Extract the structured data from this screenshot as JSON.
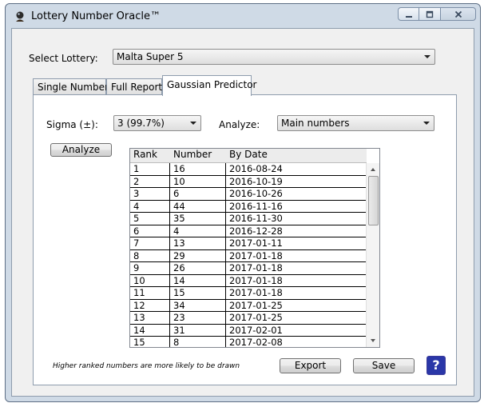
{
  "window": {
    "title": "Lottery Number Oracle™"
  },
  "select_lottery": {
    "label": "Select Lottery:",
    "value": "Malta Super 5"
  },
  "tabs": [
    {
      "label": "Single Number"
    },
    {
      "label": "Full Report"
    },
    {
      "label": "Gaussian Predictor"
    }
  ],
  "active_tab": "Gaussian Predictor",
  "sigma": {
    "label": "Sigma (±):",
    "value": "3 (99.7%)"
  },
  "analyze_select": {
    "label": "Analyze:",
    "value": "Main numbers"
  },
  "analyze_button": "Analyze",
  "table": {
    "columns": [
      "Rank",
      "Number",
      "By Date"
    ],
    "rows": [
      [
        "1",
        "16",
        "2016-08-24"
      ],
      [
        "2",
        "10",
        "2016-10-19"
      ],
      [
        "3",
        "6",
        "2016-10-26"
      ],
      [
        "4",
        "44",
        "2016-11-16"
      ],
      [
        "5",
        "35",
        "2016-11-30"
      ],
      [
        "6",
        "4",
        "2016-12-28"
      ],
      [
        "7",
        "13",
        "2017-01-11"
      ],
      [
        "8",
        "29",
        "2017-01-18"
      ],
      [
        "9",
        "26",
        "2017-01-18"
      ],
      [
        "10",
        "14",
        "2017-01-18"
      ],
      [
        "11",
        "15",
        "2017-01-18"
      ],
      [
        "12",
        "34",
        "2017-01-25"
      ],
      [
        "13",
        "23",
        "2017-01-25"
      ],
      [
        "14",
        "31",
        "2017-02-01"
      ],
      [
        "15",
        "8",
        "2017-02-08"
      ]
    ]
  },
  "footer_note": "Higher ranked numbers are more likely to be drawn",
  "export_button": "Export",
  "save_button": "Save",
  "help_button": "?",
  "colors": {
    "window_frame": "#cfdae6",
    "client_bg": "#f0f0f0",
    "help_bg": "#2a37a8"
  }
}
